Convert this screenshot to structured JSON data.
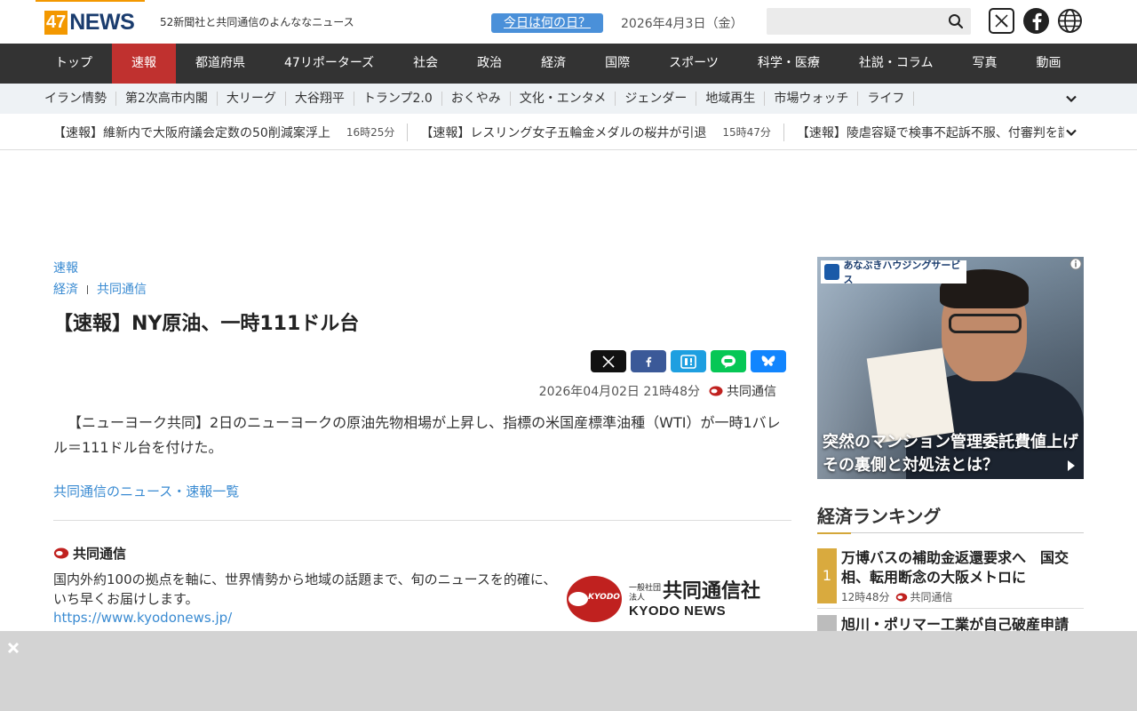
{
  "header": {
    "logo_num": "47",
    "logo_word": "NEWS",
    "tagline": "52新聞社と共同通信のよんななニュース",
    "today_button": "今日は何の日？",
    "date": "2026年4月3日（金）",
    "search_placeholder": ""
  },
  "nav": {
    "items": [
      "トップ",
      "速報",
      "都道府県",
      "47リポーターズ",
      "社会",
      "政治",
      "経済",
      "国際",
      "スポーツ",
      "科学・医療",
      "社説・コラム",
      "写真",
      "動画"
    ],
    "active": "速報"
  },
  "subnav": {
    "items": [
      "イラン情勢",
      "第2次高市内閣",
      "大リーグ",
      "大谷翔平",
      "トランプ2.0",
      "おくやみ",
      "文化・エンタメ",
      "ジェンダー",
      "地域再生",
      "市場ウォッチ",
      "ライフ"
    ]
  },
  "ticker": {
    "items": [
      {
        "text": "【速報】維新内で大阪府議会定数の50削減案浮上",
        "time": "16時25分"
      },
      {
        "text": "【速報】レスリング女子五輪金メダルの桜井が引退",
        "time": "15時47分"
      },
      {
        "text": "【速報】陵虐容疑で検事不起訴不服、付審判を請求",
        "time": ""
      }
    ]
  },
  "article": {
    "category": "速報",
    "crumb_1": "経済",
    "crumb_2": "共同通信",
    "title": "【速報】NY原油、一時111ドル台",
    "datetime": "2026年04月02日 21時48分",
    "source": "共同通信",
    "body": "【ニューヨーク共同】2日のニューヨークの原油先物相場が上昇し、指標の米国産標準油種（WTI）が一時1バレル＝111ドル台を付けた。",
    "more_link": "共同通信のニュース・速報一覧"
  },
  "source_block": {
    "name": "共同通信",
    "description": "国内外約100の拠点を軸に、世界情勢から地域の話題まで、旬のニュースを的確に、いち早くお届けします。",
    "url": "https://www.kyodonews.jp/",
    "logo_small": "一般社団法人",
    "logo_big": "共同通信社",
    "logo_en": "KYODO NEWS",
    "logo_circle": "KYODO"
  },
  "ad": {
    "brand": "あなぶきハウジングサービス",
    "caption_line1": "突然のマンション管理委託費値上げ",
    "caption_line2": "その裏側と対処法とは？"
  },
  "ranking": {
    "title": "経済ランキング",
    "items": [
      {
        "rank": "1",
        "title": "万博バスの補助金返還要求へ　国交相、転用断念の大阪メトロに",
        "time": "12時48分",
        "source": "共同通信"
      },
      {
        "rank": "",
        "title": "旭川・ポリマー工業が自己破産申請"
      }
    ]
  },
  "colors": {
    "accent_orange": "#f39800",
    "nav_active_red": "#c0312f",
    "link_blue": "#3a8bd2",
    "kyodo_red": "#c0211f"
  }
}
